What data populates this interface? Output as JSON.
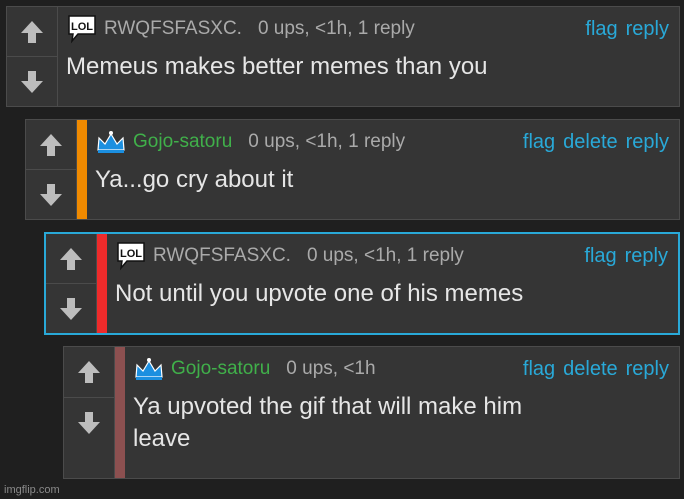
{
  "colors": {
    "background": "#1f1f1f",
    "card": "#353535",
    "link": "#29a9d8",
    "username_gray": "#aaaaaa",
    "username_green": "#40b04a",
    "bar_orange": "#f08a00",
    "bar_red": "#ee2b2b",
    "bar_brown": "#8c5050",
    "highlight_border": "#29a9d8"
  },
  "icons": {
    "upvote": "arrow-up-icon",
    "downvote": "arrow-down-icon",
    "lol_avatar": "lol-speech-bubble-icon",
    "crown_avatar": "crown-icon"
  },
  "comments": [
    {
      "username": "RWQFSFASXC.",
      "meta": "0 ups, <1h, 1 reply",
      "text": "Memeus makes better memes than you",
      "actions": [
        "flag",
        "reply"
      ]
    },
    {
      "username": "Gojo-satoru",
      "meta": "0 ups, <1h, 1 reply",
      "text": "Ya...go cry about it",
      "actions": [
        "flag",
        "delete",
        "reply"
      ]
    },
    {
      "username": "RWQFSFASXC.",
      "meta": "0 ups, <1h, 1 reply",
      "text": "Not until you upvote one of his memes",
      "actions": [
        "flag",
        "reply"
      ]
    },
    {
      "username": "Gojo-satoru",
      "meta": "0 ups, <1h",
      "text_line1": "Ya upvoted the gif that will make him",
      "text_line2": "leave",
      "actions": [
        "flag",
        "delete",
        "reply"
      ]
    }
  ],
  "avatar_lol_text": "LOL",
  "watermark": "imgflip.com"
}
